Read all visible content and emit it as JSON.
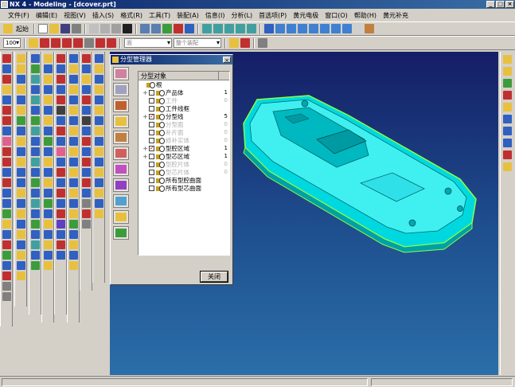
{
  "window": {
    "title": "NX 4 - Modeling - [dcover.prt]",
    "btn_min": "_",
    "btn_max": "□",
    "btn_close": "×"
  },
  "menu": [
    "文件(F)",
    "编辑(E)",
    "视图(V)",
    "插入(S)",
    "格式(R)",
    "工具(T)",
    "装配(A)",
    "信息(I)",
    "分析(L)",
    "首选项(P)",
    "黄元电极",
    "窗口(O)",
    "帮助(H)",
    "黄元补充"
  ],
  "toolbar1": {
    "start_label": "起始"
  },
  "toolbar2": {
    "zoom_value": "100",
    "filter_placeholder": "面",
    "assembly_placeholder": "整个装配"
  },
  "dialog": {
    "title": "分型管理器",
    "column_header": "分型对象",
    "close_label": "关闭",
    "tree": [
      {
        "expander": "",
        "label": "根",
        "count": "",
        "checked": false,
        "has_check": false,
        "enabled": true
      },
      {
        "expander": "+",
        "label": "产品体",
        "count": "1",
        "checked": false,
        "has_check": true,
        "enabled": true
      },
      {
        "expander": "",
        "label": "工件",
        "count": "0",
        "checked": false,
        "has_check": true,
        "enabled": false
      },
      {
        "expander": "",
        "label": "工件线框",
        "count": "",
        "checked": false,
        "has_check": true,
        "enabled": true
      },
      {
        "expander": "+",
        "label": "分型线",
        "count": "5",
        "checked": true,
        "has_check": true,
        "enabled": true
      },
      {
        "expander": "",
        "label": "分型面",
        "count": "0",
        "checked": false,
        "has_check": true,
        "enabled": false
      },
      {
        "expander": "",
        "label": "补片面",
        "count": "0",
        "checked": false,
        "has_check": true,
        "enabled": false
      },
      {
        "expander": "",
        "label": "修补实体",
        "count": "0",
        "checked": false,
        "has_check": true,
        "enabled": false
      },
      {
        "expander": "+",
        "label": "型腔区域",
        "count": "1",
        "checked": true,
        "has_check": true,
        "enabled": true
      },
      {
        "expander": "+",
        "label": "型芯区域",
        "count": "1",
        "checked": false,
        "has_check": true,
        "enabled": true
      },
      {
        "expander": "",
        "label": "型腔片体",
        "count": "0",
        "checked": false,
        "has_check": true,
        "enabled": false
      },
      {
        "expander": "",
        "label": "型芯片体",
        "count": "0",
        "checked": false,
        "has_check": true,
        "enabled": false
      },
      {
        "expander": "",
        "label": "所有型腔曲面",
        "count": "",
        "checked": false,
        "has_check": true,
        "enabled": true
      },
      {
        "expander": "",
        "label": "所有型芯曲面",
        "count": "",
        "checked": false,
        "has_check": true,
        "enabled": true
      }
    ]
  },
  "colors": {
    "viewport_top": "#151e66",
    "viewport_bottom": "#2b6ea8",
    "model_fill": "#00d8e0",
    "model_edge": "#006b70",
    "model_outline": "#8cff40"
  }
}
